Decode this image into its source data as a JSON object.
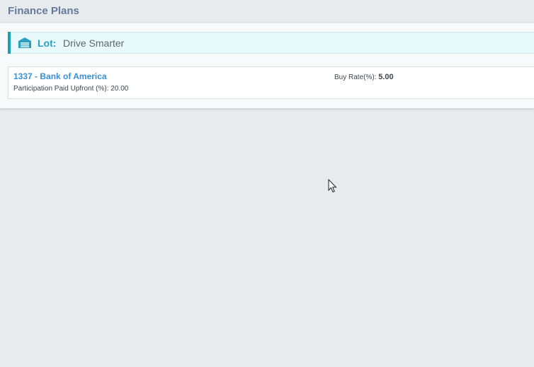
{
  "page": {
    "title": "Finance Plans"
  },
  "lot": {
    "icon": "garage-icon",
    "label": "Lot:",
    "value": "Drive Smarter"
  },
  "plans": [
    {
      "name": "1337 - Bank of America",
      "participation_label": "Participation Paid Upfront (%):",
      "participation_value": "20.00",
      "buy_rate_label": "Buy Rate(%):",
      "buy_rate_value": "5.00"
    }
  ],
  "colors": {
    "accent": "#1e9fb1",
    "link": "#3a90d4",
    "title": "#677a9c"
  }
}
